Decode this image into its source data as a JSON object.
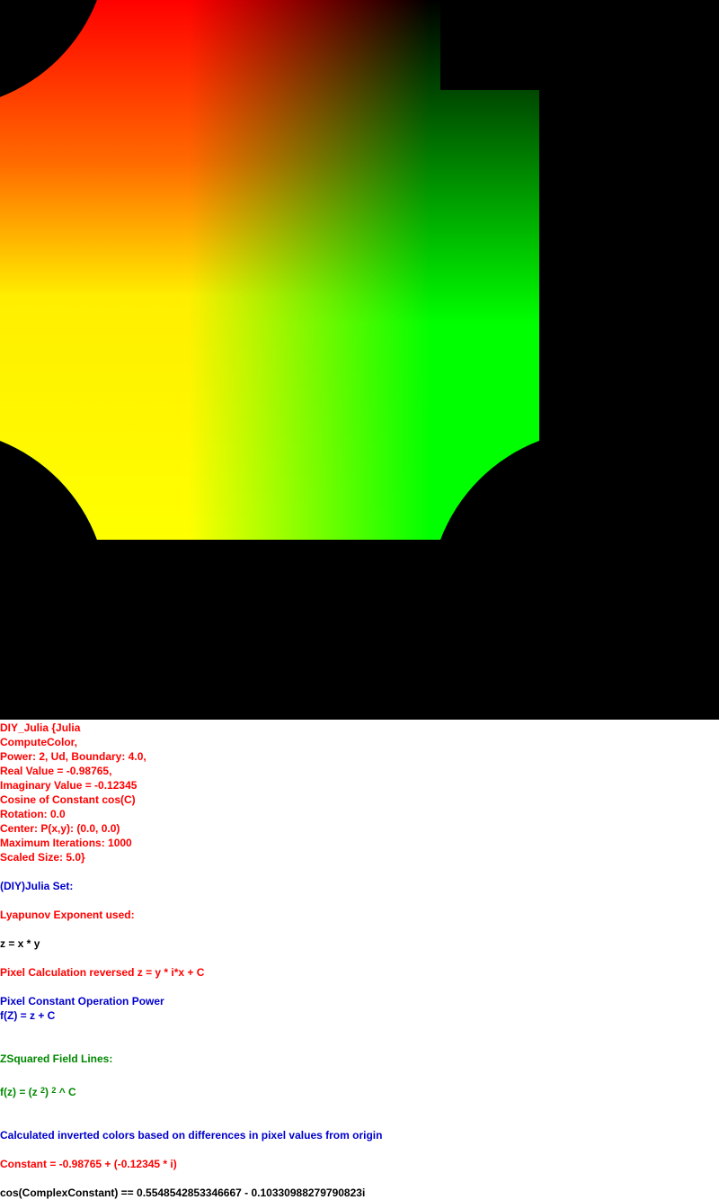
{
  "colors": {
    "canvas_bg": "#000000",
    "red_text": "#ff0000",
    "blue_text": "#0000cc",
    "green_text": "#008800",
    "black_text": "#000000"
  },
  "params": {
    "line1": "DIY_Julia {Julia",
    "line2": "ComputeColor,",
    "line3": "Power: 2, Ud, Boundary: 4.0,",
    "line4": "Real Value = -0.98765,",
    "line5": "Imaginary Value = -0.12345",
    "line6": "Cosine of Constant cos(C)",
    "line7": "Rotation: 0.0",
    "line8": "Center: P(x,y): (0.0, 0.0)",
    "line9": "Maximum Iterations: 1000",
    "line10": "Scaled Size: 5.0}"
  },
  "notes": {
    "julia_set": "(DIY)Julia Set:",
    "lyapunov": "Lyapunov Exponent used:",
    "z_eq": "z = x * y",
    "pixel_calc": "Pixel Calculation reversed z = y * i*x + C",
    "pixel_constant": "Pixel Constant Operation Power",
    "f_z": "f(Z) = z + C",
    "zsquared": "ZSquared Field Lines:",
    "formula_prefix": "f(z) = (z ",
    "formula_exp1": "2",
    "formula_mid": ") ",
    "formula_exp2": "2",
    "formula_suffix": " ^ C",
    "inverted_colors": "Calculated inverted colors based on differences in pixel values from origin",
    "constant": "Constant = -0.98765 + (-0.12345 * i)",
    "cos_constant": "cos(ComplexConstant) == 0.5548542853346667 - 0.10330988279790823i"
  }
}
